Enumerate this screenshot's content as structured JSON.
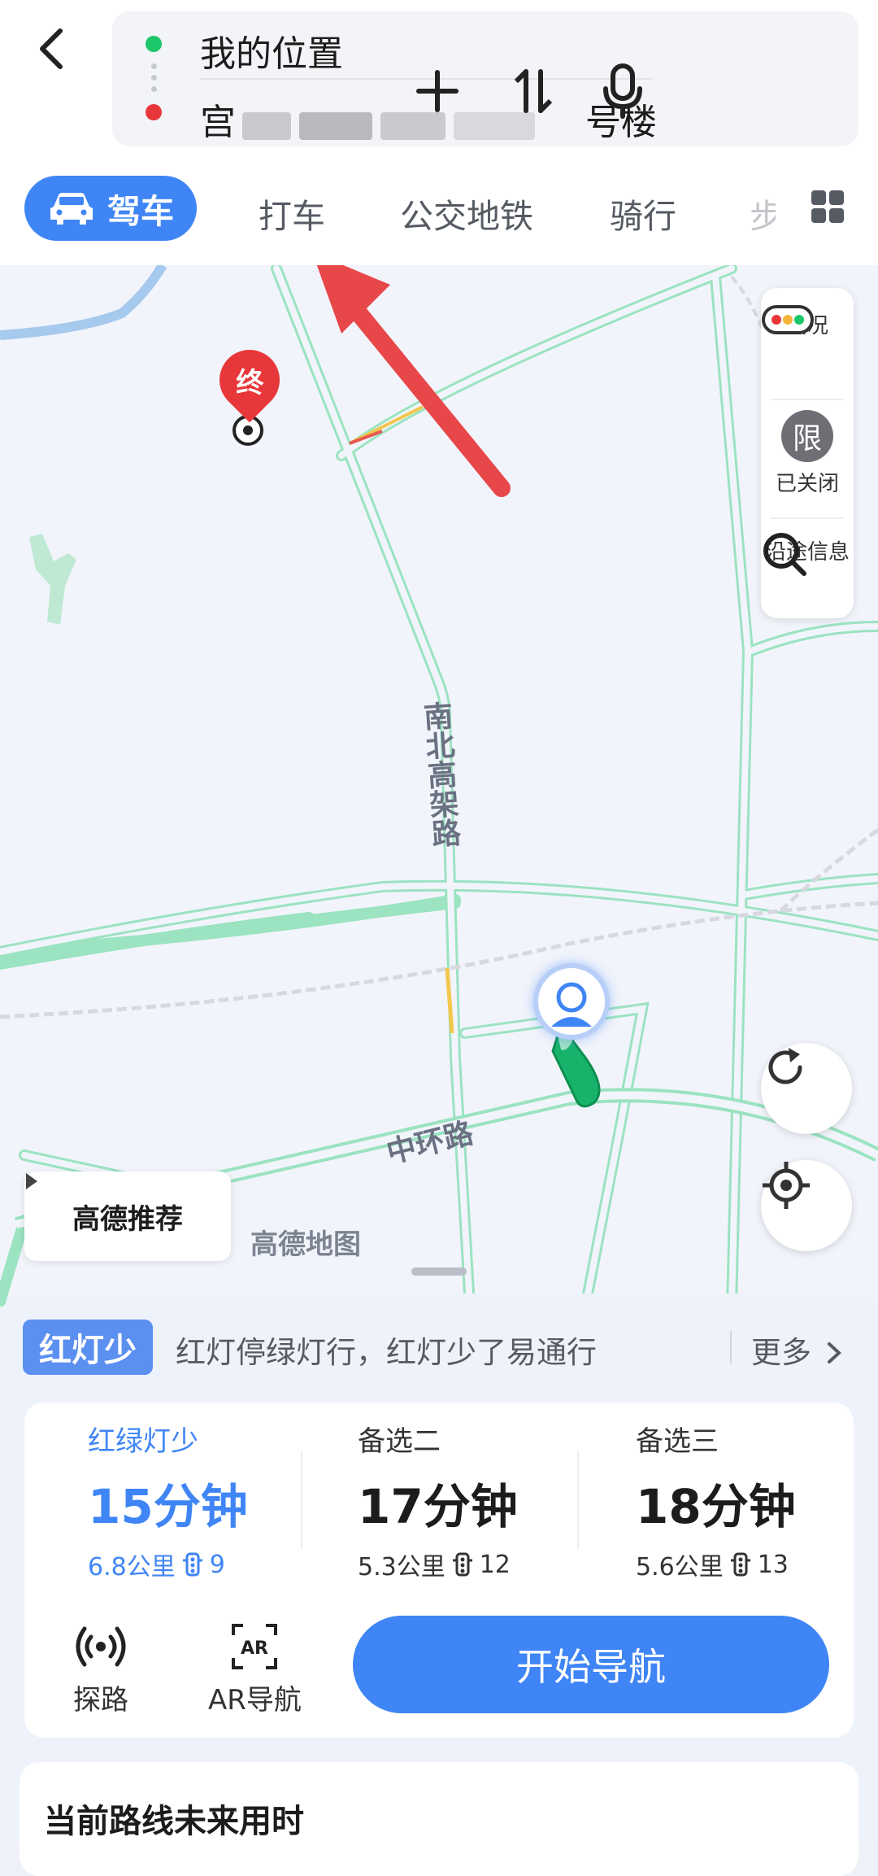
{
  "search": {
    "origin": "我的位置",
    "destination": "宫",
    "destination_tail": "号楼"
  },
  "tabs": [
    {
      "label": "驾车",
      "active": true
    },
    {
      "label": "打车"
    },
    {
      "label": "公交地铁"
    },
    {
      "label": "骑行"
    },
    {
      "label": "步"
    }
  ],
  "map": {
    "road_labels": {
      "north_south": "南北高架路",
      "ring": "中环路"
    },
    "end_marker": "终",
    "panel": {
      "traffic": "路况",
      "restriction_icon": "限",
      "restriction": "已关闭",
      "along_route": "沿途信息"
    },
    "recommend": "高德推荐",
    "watermark": "高德地图"
  },
  "sheet": {
    "tip_badge": "红灯少",
    "tip_text": "红灯停绿灯行，红灯少了易通行",
    "more": "更多",
    "routes": [
      {
        "title": "红绿灯少",
        "time": "15分钟",
        "distance": "6.8公里",
        "lights": "9",
        "selected": true
      },
      {
        "title": "备选二",
        "time": "17分钟",
        "distance": "5.3公里",
        "lights": "12"
      },
      {
        "title": "备选三",
        "time": "18分钟",
        "distance": "5.6公里",
        "lights": "13"
      }
    ],
    "actions": {
      "explore": "探路",
      "ar_nav": "AR导航",
      "start": "开始导航"
    },
    "future_title": "当前路线未来用时"
  },
  "colors": {
    "accent": "#3f85f5",
    "route_green": "#18b36b",
    "destination_red": "#e8373a",
    "annotation_arrow": "#e8474a"
  }
}
